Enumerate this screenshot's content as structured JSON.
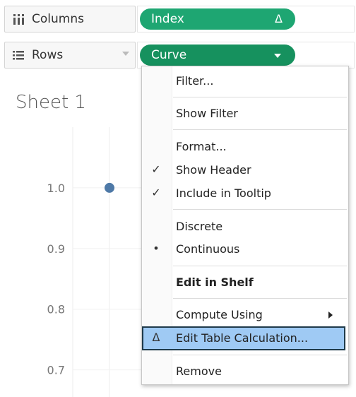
{
  "shelves": {
    "columns": {
      "label": "Columns",
      "icon": "columns-icon",
      "pill": {
        "label": "Index",
        "badge": "Δ",
        "color": "#1ea672"
      }
    },
    "rows": {
      "label": "Rows",
      "icon": "rows-icon",
      "pill": {
        "label": "Curve",
        "color": "#16915e"
      }
    }
  },
  "sheet": {
    "title": "Sheet 1"
  },
  "chart_data": {
    "type": "scatter",
    "y_ticks": [
      "1.0",
      "0.9",
      "0.8",
      "0.7"
    ],
    "points": [
      {
        "y": 1.0
      }
    ],
    "ylim": [
      0.66,
      1.1
    ],
    "grid": true,
    "mark_color": "#4e79a7"
  },
  "context_menu": {
    "items": [
      {
        "label": "Filter...",
        "mark": ""
      },
      {
        "label": "Show Filter",
        "mark": ""
      },
      {
        "label": "Format...",
        "mark": ""
      },
      {
        "label": "Show Header",
        "mark": "✓"
      },
      {
        "label": "Include in Tooltip",
        "mark": "✓"
      },
      {
        "label": "Discrete",
        "mark": ""
      },
      {
        "label": "Continuous",
        "mark": "•"
      },
      {
        "label": "Edit in Shelf",
        "mark": ""
      },
      {
        "label": "Compute Using",
        "mark": ""
      },
      {
        "label": "Edit Table Calculation...",
        "mark": "Δ"
      },
      {
        "label": "Remove",
        "mark": ""
      }
    ],
    "highlight_color": "#9fcaf4"
  }
}
